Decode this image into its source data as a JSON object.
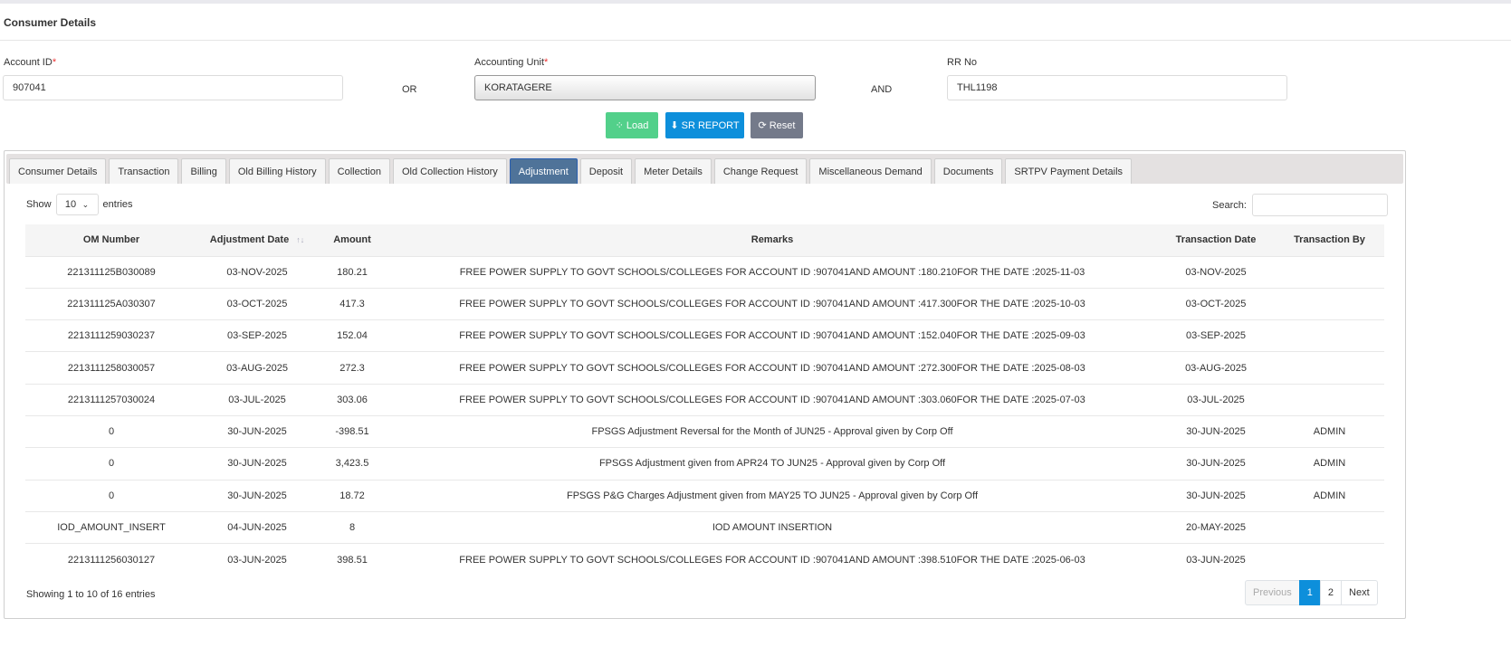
{
  "header": {
    "title": "Consumer Details"
  },
  "form": {
    "account_id": {
      "label": "Account ID",
      "required": "*",
      "value": "907041"
    },
    "or_label": "OR",
    "accounting_unit": {
      "label": "Accounting Unit",
      "required": "*",
      "value": "KORATAGERE"
    },
    "and_label": "AND",
    "rr_no": {
      "label": "RR No",
      "value": "THL1198"
    }
  },
  "buttons": {
    "load": "Load",
    "sr_report": "SR REPORT",
    "reset": "Reset"
  },
  "colors": {
    "load": "#52d08a",
    "sr_report": "#0d8fdb",
    "reset": "#747a8a",
    "active_tab": "#4f7399"
  },
  "tabs": [
    "Consumer Details",
    "Transaction",
    "Billing",
    "Old Billing History",
    "Collection",
    "Old Collection History",
    "Adjustment",
    "Deposit",
    "Meter Details",
    "Change Request",
    "Miscellaneous Demand",
    "Documents",
    "SRTPV Payment Details"
  ],
  "active_tab": "Adjustment",
  "table_controls": {
    "show": "Show",
    "entries_value": "10",
    "entries": "entries",
    "search_label": "Search:",
    "search_value": ""
  },
  "columns": [
    "OM Number",
    "Adjustment Date",
    "Amount",
    "Remarks",
    "Transaction Date",
    "Transaction By"
  ],
  "rows": [
    [
      "221311125B030089",
      "03-NOV-2025",
      "180.21",
      "FREE POWER SUPPLY TO GOVT SCHOOLS/COLLEGES FOR ACCOUNT ID :907041AND AMOUNT :180.210FOR THE DATE :2025-11-03",
      "03-NOV-2025",
      ""
    ],
    [
      "221311125A030307",
      "03-OCT-2025",
      "417.3",
      "FREE POWER SUPPLY TO GOVT SCHOOLS/COLLEGES FOR ACCOUNT ID :907041AND AMOUNT :417.300FOR THE DATE :2025-10-03",
      "03-OCT-2025",
      ""
    ],
    [
      "2213111259030237",
      "03-SEP-2025",
      "152.04",
      "FREE POWER SUPPLY TO GOVT SCHOOLS/COLLEGES FOR ACCOUNT ID :907041AND AMOUNT :152.040FOR THE DATE :2025-09-03",
      "03-SEP-2025",
      ""
    ],
    [
      "2213111258030057",
      "03-AUG-2025",
      "272.3",
      "FREE POWER SUPPLY TO GOVT SCHOOLS/COLLEGES FOR ACCOUNT ID :907041AND AMOUNT :272.300FOR THE DATE :2025-08-03",
      "03-AUG-2025",
      ""
    ],
    [
      "2213111257030024",
      "03-JUL-2025",
      "303.06",
      "FREE POWER SUPPLY TO GOVT SCHOOLS/COLLEGES FOR ACCOUNT ID :907041AND AMOUNT :303.060FOR THE DATE :2025-07-03",
      "03-JUL-2025",
      ""
    ],
    [
      "0",
      "30-JUN-2025",
      "-398.51",
      "FPSGS Adjustment Reversal for the Month of JUN25 - Approval given by Corp Off",
      "30-JUN-2025",
      "ADMIN"
    ],
    [
      "0",
      "30-JUN-2025",
      "3,423.5",
      "FPSGS Adjustment given from APR24 TO JUN25 - Approval given by Corp Off",
      "30-JUN-2025",
      "ADMIN"
    ],
    [
      "0",
      "30-JUN-2025",
      "18.72",
      "FPSGS P&G Charges Adjustment given from MAY25 TO JUN25 - Approval given by Corp Off",
      "30-JUN-2025",
      "ADMIN"
    ],
    [
      "IOD_AMOUNT_INSERT",
      "04-JUN-2025",
      "8",
      "IOD AMOUNT INSERTION",
      "20-MAY-2025",
      ""
    ],
    [
      "2213111256030127",
      "03-JUN-2025",
      "398.51",
      "FREE POWER SUPPLY TO GOVT SCHOOLS/COLLEGES FOR ACCOUNT ID :907041AND AMOUNT :398.510FOR THE DATE :2025-06-03",
      "03-JUN-2025",
      ""
    ]
  ],
  "footer": {
    "info": "Showing 1 to 10 of 16 entries",
    "previous": "Previous",
    "pages": [
      "1",
      "2"
    ],
    "next": "Next",
    "current_page": "1"
  }
}
